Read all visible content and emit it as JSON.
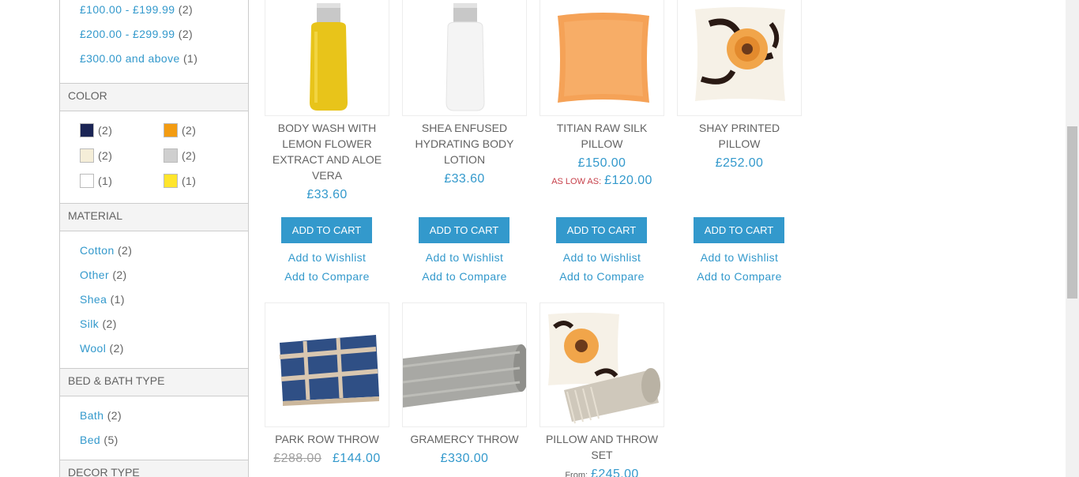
{
  "price_filters": [
    {
      "label": "£100.00 - £199.99",
      "count": "(2)"
    },
    {
      "label": "£200.00 - £299.99",
      "count": "(2)"
    },
    {
      "label": "£300.00 and above",
      "count": "(1)"
    }
  ],
  "color": {
    "heading": "COLOR",
    "swatches": [
      {
        "name": "navy",
        "hex": "#1b2555",
        "count": "(2)"
      },
      {
        "name": "orange",
        "hex": "#f39c12",
        "count": "(2)"
      },
      {
        "name": "cream",
        "hex": "#f5eed8",
        "count": "(2)"
      },
      {
        "name": "grey",
        "hex": "#cfcfcf",
        "count": "(2)"
      },
      {
        "name": "white",
        "hex": "#ffffff",
        "count": "(1)"
      },
      {
        "name": "yellow",
        "hex": "#ffe52c",
        "count": "(1)"
      }
    ]
  },
  "material": {
    "heading": "MATERIAL",
    "items": [
      {
        "label": "Cotton",
        "count": "(2)"
      },
      {
        "label": "Other",
        "count": "(2)"
      },
      {
        "label": "Shea",
        "count": "(1)"
      },
      {
        "label": "Silk",
        "count": "(2)"
      },
      {
        "label": "Wool",
        "count": "(2)"
      }
    ]
  },
  "bed_bath": {
    "heading": "BED & BATH TYPE",
    "items": [
      {
        "label": "Bath",
        "count": "(2)"
      },
      {
        "label": "Bed",
        "count": "(5)"
      }
    ]
  },
  "decor": {
    "heading": "DECOR TYPE"
  },
  "products": [
    {
      "name": "BODY WASH WITH LEMON FLOWER EXTRACT AND ALOE VERA",
      "price": "£33.60",
      "add_to_cart": "ADD TO CART",
      "wishlist": "Add to Wishlist",
      "compare": "Add to Compare"
    },
    {
      "name": "SHEA ENFUSED HYDRATING BODY LOTION",
      "price": "£33.60",
      "add_to_cart": "ADD TO CART",
      "wishlist": "Add to Wishlist",
      "compare": "Add to Compare"
    },
    {
      "name": "TITIAN RAW SILK PILLOW",
      "price": "£150.00",
      "low_label": "AS LOW AS:",
      "low_price": "£120.00",
      "add_to_cart": "ADD TO CART",
      "wishlist": "Add to Wishlist",
      "compare": "Add to Compare"
    },
    {
      "name": "SHAY PRINTED PILLOW",
      "price": "£252.00",
      "add_to_cart": "ADD TO CART",
      "wishlist": "Add to Wishlist",
      "compare": "Add to Compare"
    },
    {
      "name": "PARK ROW THROW",
      "old_price": "£288.00",
      "price": "£144.00"
    },
    {
      "name": "GRAMERCY THROW",
      "price": "£330.00"
    },
    {
      "name": "PILLOW AND THROW SET",
      "from_label": "From:",
      "price": "£245.00"
    }
  ]
}
